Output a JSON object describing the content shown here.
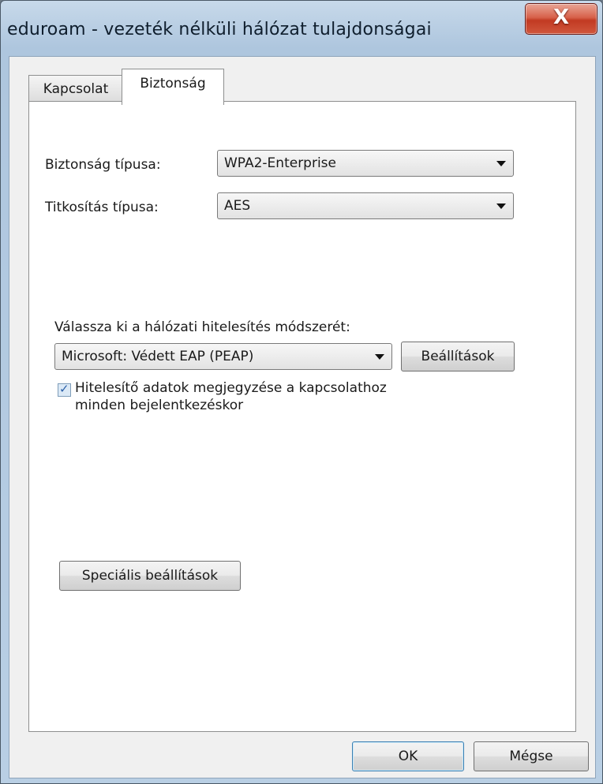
{
  "window": {
    "title": "eduroam - vezeték nélküli hálózat tulajdonságai",
    "close_label": "X"
  },
  "tabs": [
    {
      "label": "Kapcsolat",
      "active": false
    },
    {
      "label": "Biztonság",
      "active": true
    }
  ],
  "security": {
    "type_label": "Biztonság típusa:",
    "type_value": "WPA2-Enterprise",
    "encryption_label": "Titkosítás típusa:",
    "encryption_value": "AES"
  },
  "auth": {
    "method_label": "Válassza ki a hálózati hitelesítés módszerét:",
    "method_value": "Microsoft: Védett EAP (PEAP)",
    "settings_button": "Beállítások",
    "remember_checked": true,
    "remember_line1": "Hitelesítő adatok megjegyzése a kapcsolathoz",
    "remember_line2": "minden bejelentkezéskor"
  },
  "advanced_button": "Speciális beállítások",
  "footer": {
    "ok": "OK",
    "cancel": "Mégse"
  }
}
